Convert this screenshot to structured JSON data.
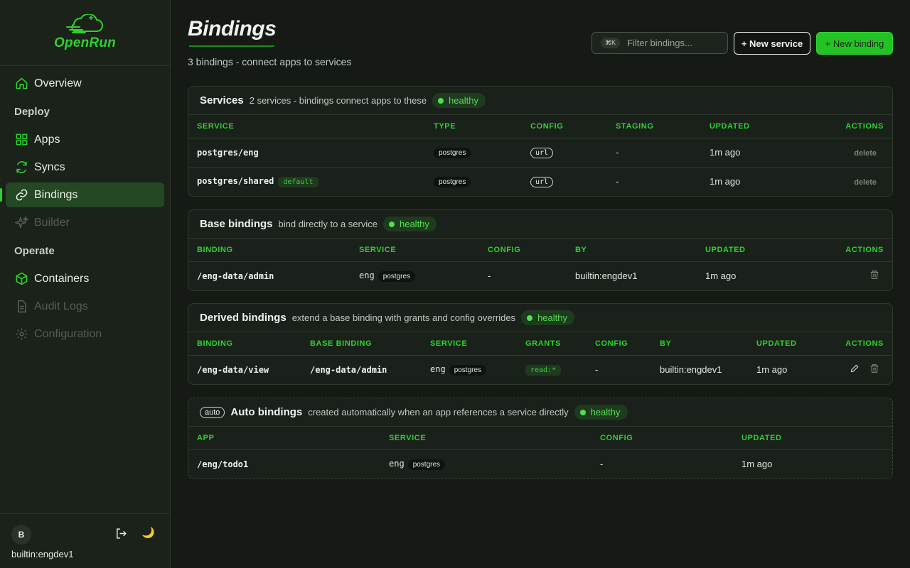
{
  "app": {
    "logo_text": "OpenRun"
  },
  "sidebar": {
    "items": [
      {
        "label": "Overview"
      },
      {
        "section": "Deploy"
      },
      {
        "label": "Apps"
      },
      {
        "label": "Syncs"
      },
      {
        "label": "Bindings",
        "active": true
      },
      {
        "label": "Builder",
        "disabled": true
      },
      {
        "section": "Operate"
      },
      {
        "label": "Containers"
      },
      {
        "label": "Audit Logs",
        "disabled": true
      },
      {
        "label": "Configuration",
        "disabled": true
      }
    ],
    "user": {
      "avatar_letter": "B",
      "name": "builtin:engdev1"
    }
  },
  "header": {
    "title": "Bindings",
    "subtitle": "3 bindings - connect apps to services",
    "filter_kbd": "⌘K",
    "filter_placeholder": "Filter bindings...",
    "new_service_label": "+ New service",
    "new_binding_label": "+ New binding"
  },
  "services": {
    "title": "Services",
    "desc": "2 services - bindings connect apps to these",
    "health": "healthy",
    "columns": [
      "SERVICE",
      "TYPE",
      "CONFIG",
      "STAGING",
      "UPDATED",
      "ACTIONS"
    ],
    "rows": [
      {
        "service": "postgres/eng",
        "badge": "",
        "type": "postgres",
        "config": "url",
        "staging": "-",
        "updated": "1m ago",
        "action": "delete"
      },
      {
        "service": "postgres/shared",
        "badge": "default",
        "type": "postgres",
        "config": "url",
        "staging": "-",
        "updated": "1m ago",
        "action": "delete"
      }
    ]
  },
  "base": {
    "title": "Base bindings",
    "desc": "bind directly to a service",
    "health": "healthy",
    "columns": [
      "BINDING",
      "SERVICE",
      "CONFIG",
      "BY",
      "UPDATED",
      "ACTIONS"
    ],
    "rows": [
      {
        "binding": "/eng-data/admin",
        "service": "eng",
        "service_type": "postgres",
        "config": "-",
        "by": "builtin:engdev1",
        "updated": "1m ago"
      }
    ]
  },
  "derived": {
    "title": "Derived bindings",
    "desc": "extend a base binding with grants and config overrides",
    "health": "healthy",
    "columns": [
      "BINDING",
      "BASE BINDING",
      "SERVICE",
      "GRANTS",
      "CONFIG",
      "BY",
      "UPDATED",
      "ACTIONS"
    ],
    "rows": [
      {
        "binding": "/eng-data/view",
        "base": "/eng-data/admin",
        "service": "eng",
        "service_type": "postgres",
        "grants": "read:*",
        "config": "-",
        "by": "builtin:engdev1",
        "updated": "1m ago"
      }
    ]
  },
  "auto": {
    "pill": "auto",
    "title": "Auto bindings",
    "desc": "created automatically when an app references a service directly",
    "health": "healthy",
    "columns": [
      "APP",
      "SERVICE",
      "CONFIG",
      "UPDATED"
    ],
    "rows": [
      {
        "app": "/eng/todo1",
        "service": "eng",
        "service_type": "postgres",
        "config": "-",
        "updated": "1m ago"
      }
    ]
  },
  "colors": {
    "accent": "#2fd12f",
    "background": "#151a15",
    "sidebar": "#1a221a",
    "active_nav": "#234823",
    "healthy": "#4fe04f"
  }
}
